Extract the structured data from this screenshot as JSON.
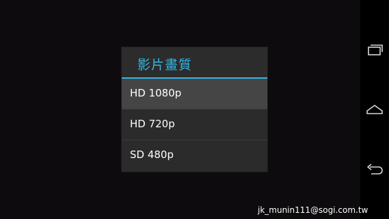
{
  "dialog": {
    "title": "影片畫質",
    "options": [
      {
        "label": "HD 1080p",
        "selected": true
      },
      {
        "label": "HD 720p",
        "selected": false
      },
      {
        "label": "SD 480p",
        "selected": false
      }
    ]
  },
  "navbar": {
    "icons": [
      "recent-apps-icon",
      "home-icon",
      "back-icon"
    ]
  },
  "watermark": "jk_munin111@sogi.com.tw",
  "colors": {
    "accent": "#33b5e5",
    "dialog_bg": "#2a2a2a",
    "selected_bg": "#454545",
    "background": "#0d0b0d"
  }
}
